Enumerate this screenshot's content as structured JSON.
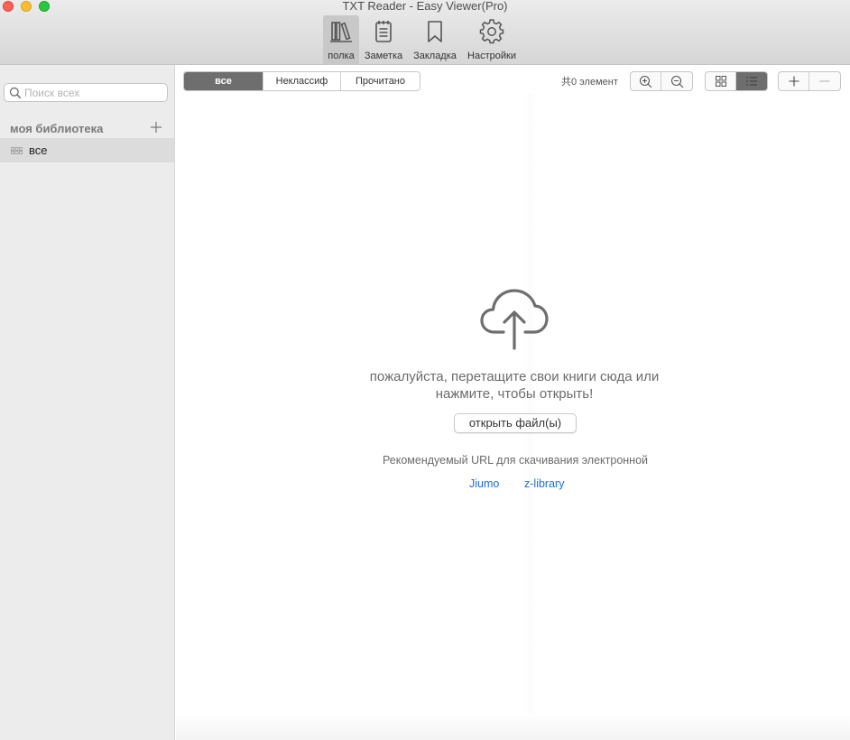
{
  "window": {
    "title": "TXT Reader - Easy Viewer(Pro)"
  },
  "toolbar": {
    "items": [
      {
        "label": "полка",
        "icon": "bookshelf-icon",
        "active": true
      },
      {
        "label": "Заметка",
        "icon": "notepad-icon",
        "active": false
      },
      {
        "label": "Закладка",
        "icon": "bookmark-icon",
        "active": false
      },
      {
        "label": "Настройки",
        "icon": "gear-icon",
        "active": false
      }
    ]
  },
  "sidebar": {
    "search_placeholder": "Поиск всех",
    "library_title": "моя библиотека",
    "items": [
      {
        "label": "все",
        "icon": "grid-icon",
        "selected": true
      }
    ]
  },
  "filters": {
    "tabs": [
      {
        "label": "все",
        "active": true
      },
      {
        "label": "Неклассиф",
        "active": false
      },
      {
        "label": "Прочитано",
        "active": false
      }
    ],
    "count_text": "共0 элемент"
  },
  "empty_state": {
    "line1": "пожалуйста, перетащите свои книги сюда или",
    "line2": "нажмите, чтобы открыть!",
    "open_button": "открыть файл(ы)",
    "recommend_text": "Рекомендуемый URL для скачивания электронной",
    "links": [
      "Jiumo",
      "z-library"
    ]
  },
  "colors": {
    "accent": "#6e6e6e",
    "link": "#1a6fd1",
    "sidebar_bg": "#ececec"
  }
}
